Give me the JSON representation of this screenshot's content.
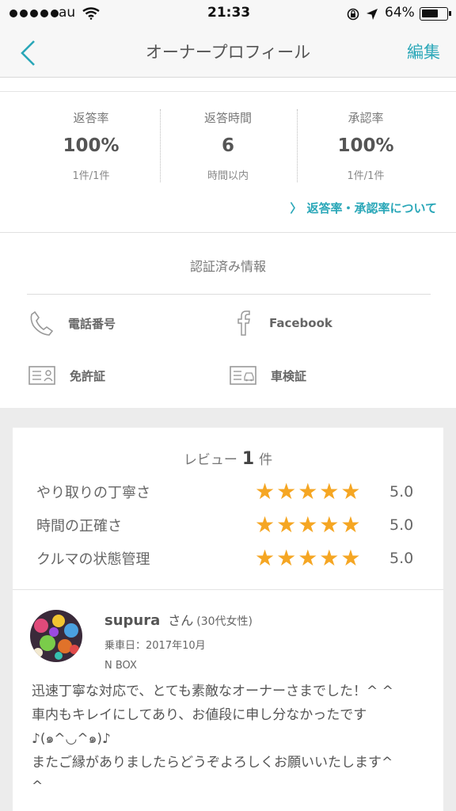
{
  "status": {
    "carrier": "au",
    "time": "21:33",
    "battery": "64%"
  },
  "nav": {
    "title": "オーナープロフィール",
    "edit": "編集"
  },
  "stats": [
    {
      "label": "返答率",
      "value": "100%",
      "sub": "1件/1件"
    },
    {
      "label": "返答時間",
      "value": "6",
      "sub": "時間以内"
    },
    {
      "label": "承認率",
      "value": "100%",
      "sub": "1件/1件"
    }
  ],
  "rate_link": "返答率・承認率について",
  "verified": {
    "title": "認証済み情報",
    "items": [
      {
        "label": "電話番号",
        "icon": "phone-icon"
      },
      {
        "label": "Facebook",
        "icon": "facebook-icon"
      },
      {
        "label": "免許証",
        "icon": "license-card-icon"
      },
      {
        "label": "車検証",
        "icon": "vehicle-inspection-icon"
      }
    ]
  },
  "reviews": {
    "prefix": "レビュー",
    "count": "1",
    "suffix": "件",
    "ratings": [
      {
        "label": "やり取りの丁寧さ",
        "stars": "★★★★★",
        "score": "5.0",
        "value": 5.0
      },
      {
        "label": "時間の正確さ",
        "stars": "★★★★★",
        "score": "5.0",
        "value": 5.0
      },
      {
        "label": "クルマの状態管理",
        "stars": "★★★★★",
        "score": "5.0",
        "value": 5.0
      }
    ],
    "reviewer": {
      "name": "supura",
      "honorific": "さん",
      "age": "(30代女性)",
      "ride_date": "乗車日：2017年10月",
      "car": "N BOX"
    },
    "text_lines": [
      "迅速丁寧な対応で、とても素敵なオーナーさまでした！^ ^",
      "車内もキレイにしてあり、お値段に申し分なかったです",
      "♪(๑^◡^๑)♪",
      "またご縁がありましたらどうぞよろしくお願いいたします^",
      "^"
    ]
  },
  "colors": {
    "accent": "#2aa7b8",
    "star": "#f5a623",
    "background_grey": "#ececec"
  }
}
